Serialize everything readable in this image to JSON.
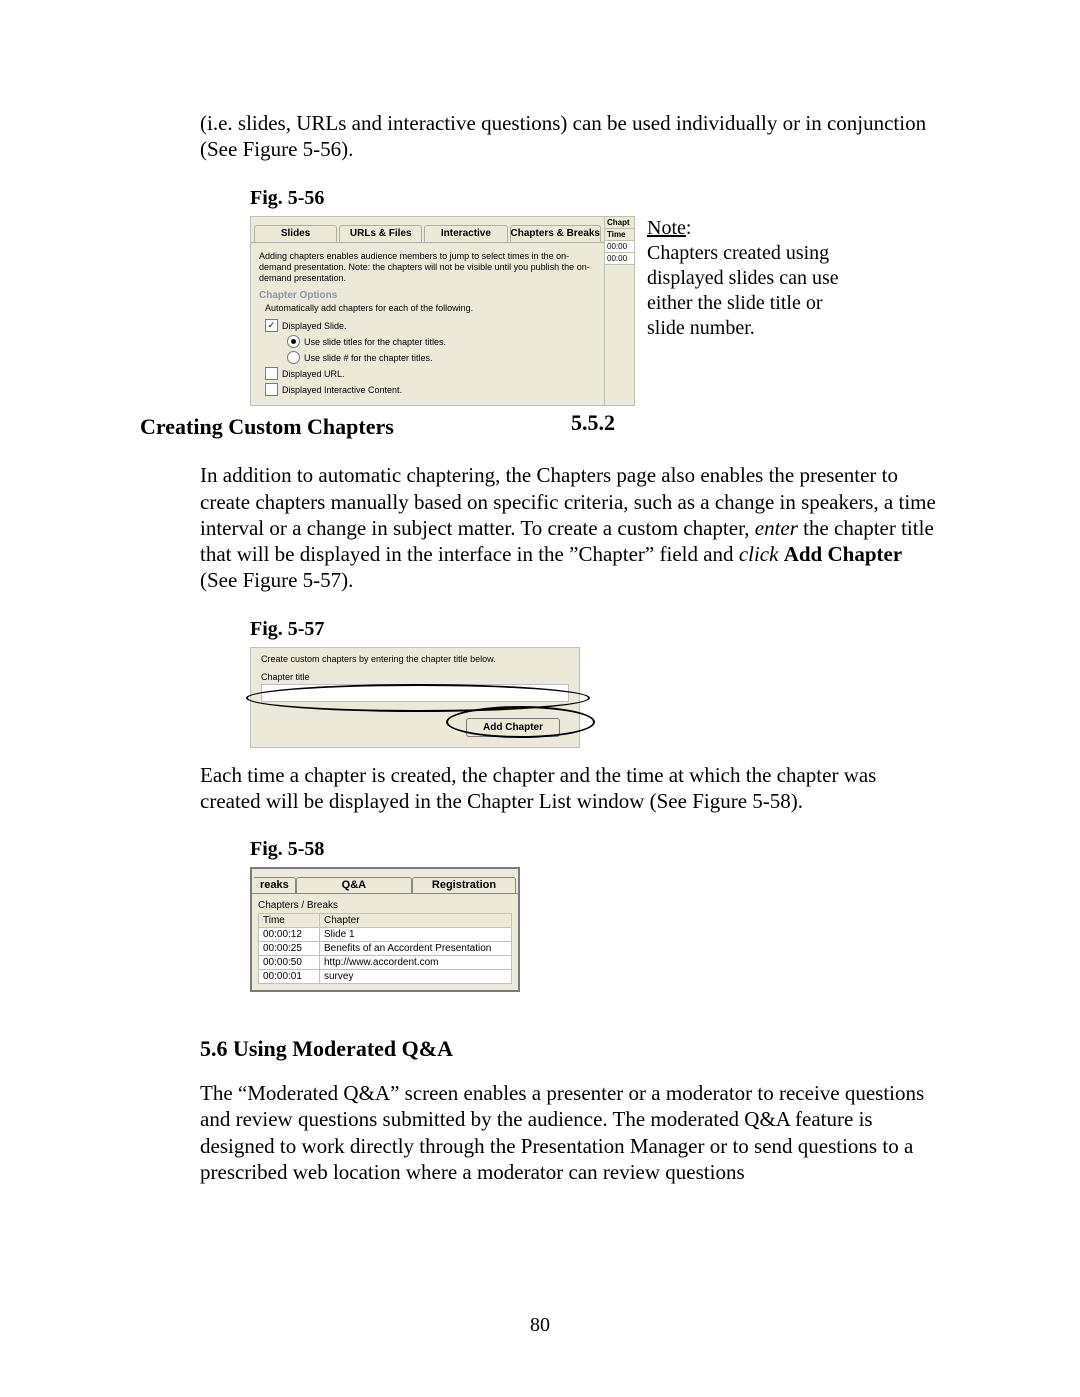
{
  "para1_prefix": "(i.e. slides, URLs and interactive questions) can be used individually or in conjunction (See Figure 5-56).",
  "fig56": {
    "label": "Fig. 5-56",
    "tabs": [
      "Slides",
      "URLs & Files",
      "Interactive",
      "Chapters & Breaks"
    ],
    "intro": "Adding chapters enables audience members to jump to select times in the on-demand presentation. Note: the chapters will not be visible until you publish the on-demand presentation.",
    "group_title": "Chapter Options",
    "subtext": "Automatically add chapters for each of the following.",
    "cb_slide": "Displayed Slide.",
    "rb_titles": "Use slide titles for the chapter titles.",
    "rb_nums": "Use slide # for the chapter titles.",
    "cb_url": "Displayed URL.",
    "cb_int": "Displayed Interactive Content.",
    "side_headers": [
      "Chapt",
      "Time"
    ],
    "side_cells": [
      "00:00",
      "00:00"
    ]
  },
  "note": {
    "title": "Note",
    "body": "Chapters created using displayed slides can use either the slide title or slide number."
  },
  "sec552_num": "5.5.2",
  "sec552_title": "Creating Custom Chapters",
  "para2_a": "In addition to automatic chaptering, the Chapters page also enables the presenter to create chapters manually based on specific criteria, such as a change in speakers, a time interval or a change in subject matter.  To create a custom chapter, ",
  "para2_enter": "enter",
  "para2_b": " the chapter title that will be displayed in the interface in the ”Chapter” field and ",
  "para2_click": "click",
  "para2_c": " ",
  "para2_bold": "Add Chapter",
  "para2_d": " (See Figure 5-57).",
  "fig57": {
    "label": "Fig. 5-57",
    "legend": "Create custom chapters by entering the chapter title below.",
    "field_label": "Chapter title",
    "button": "Add Chapter"
  },
  "para3": "Each time a chapter is created, the chapter and the time at which the chapter was created will be displayed in the Chapter List window (See Figure 5-58).",
  "fig58": {
    "label": "Fig. 5-58",
    "tabs": [
      "reaks",
      "Q&A",
      "Registration"
    ],
    "group": "Chapters / Breaks",
    "headers": [
      "Time",
      "Chapter"
    ],
    "rows": [
      [
        "00:00:12",
        "Slide 1"
      ],
      [
        "00:00:25",
        "Benefits of an Accordent Presentation"
      ],
      [
        "00:00:50",
        "http://www.accordent.com"
      ],
      [
        "00:00:01",
        "survey"
      ]
    ]
  },
  "sec56_title": "5.6  Using Moderated Q&A",
  "para4": "The “Moderated Q&A” screen enables a presenter or a moderator to receive questions and review questions submitted by the audience.  The moderated Q&A feature is designed to work directly through the Presentation Manager or to send questions to a prescribed web location where a moderator can review questions",
  "page_number": "80"
}
